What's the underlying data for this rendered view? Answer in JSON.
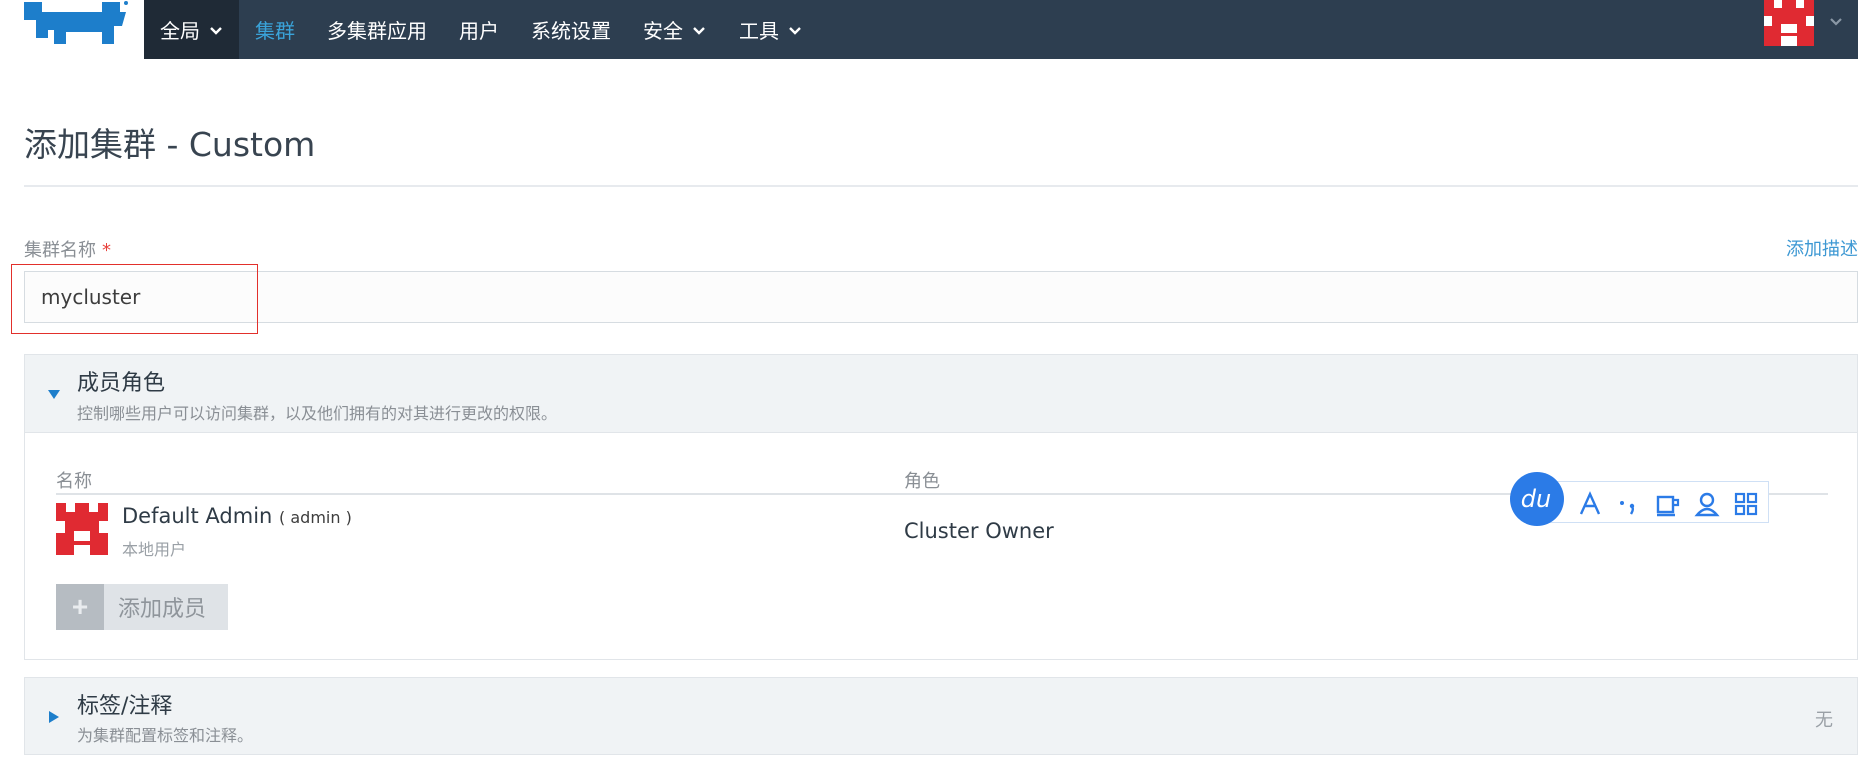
{
  "header": {
    "nav": [
      {
        "label": "全局",
        "dropdown": true
      },
      {
        "label": "集群",
        "active": true
      },
      {
        "label": "多集群应用"
      },
      {
        "label": "用户"
      },
      {
        "label": "系统设置"
      },
      {
        "label": "安全",
        "dropdown": true
      },
      {
        "label": "工具",
        "dropdown": true
      }
    ],
    "avatar_icon": "user-avatar-icon"
  },
  "page": {
    "title": "添加集群 - Custom"
  },
  "cluster_name": {
    "label": "集群名称",
    "required_mark": "*",
    "value": "mycluster",
    "add_description_link": "添加描述"
  },
  "members": {
    "title": "成员角色",
    "description": "控制哪些用户可以访问集群，以及他们拥有的对其进行更改的权限。",
    "columns": {
      "name": "名称",
      "role": "角色"
    },
    "rows": [
      {
        "name": "Default Admin",
        "login": "( admin )",
        "type": "本地用户",
        "role": "Cluster Owner"
      }
    ],
    "add_button": {
      "icon": "+",
      "label": "添加成员"
    }
  },
  "labels": {
    "title": "标签/注释",
    "description": "为集群配置标签和注释。",
    "status": "无"
  },
  "colors": {
    "nav_bg": "#2d3e50",
    "nav_global_bg": "#1f2a36",
    "accent": "#3d98d3",
    "required": "#e8413c",
    "highlight": "#e2302b",
    "avatar_red": "#e02a32"
  },
  "floating_toolbar": {
    "logo_text": "du",
    "icons": [
      "font-icon",
      "punctuation-icon",
      "cup-icon",
      "user-icon",
      "grid-icon"
    ]
  }
}
